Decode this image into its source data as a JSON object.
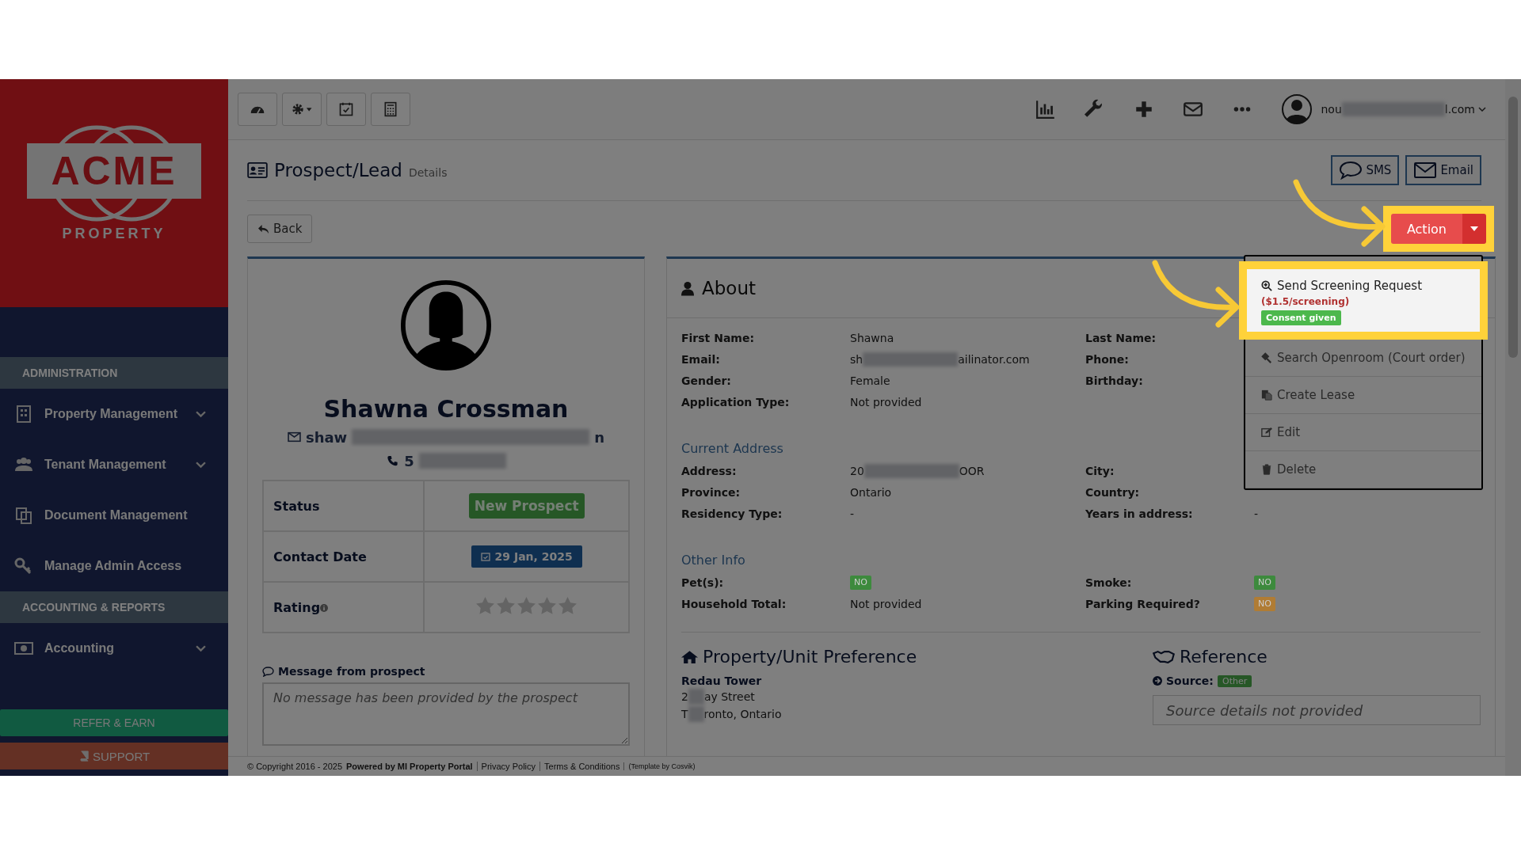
{
  "sidebar": {
    "logo": {
      "word": "ACME",
      "subword": "PROPERTY"
    },
    "sections": [
      {
        "title": "ADMINISTRATION",
        "items": [
          {
            "label": "Property Management",
            "has_submenu": true
          },
          {
            "label": "Tenant Management",
            "has_submenu": true
          },
          {
            "label": "Document Management",
            "has_submenu": false
          },
          {
            "label": "Manage Admin Access",
            "has_submenu": false
          }
        ]
      },
      {
        "title": "ACCOUNTING & REPORTS",
        "items": [
          {
            "label": "Accounting",
            "has_submenu": true
          }
        ]
      }
    ],
    "refer_button": "REFER & EARN",
    "support_button": "SUPPORT"
  },
  "topbar": {
    "user": {
      "name_start": "nou",
      "name_end": "l.com"
    }
  },
  "header": {
    "title": "Prospect/Lead",
    "subtitle": "Details",
    "buttons": [
      "SMS",
      "Email"
    ],
    "back": "Back",
    "action": {
      "label": "Action",
      "highlighted": true
    }
  },
  "action_menu": [
    {
      "label": "Send Screening Request",
      "price": "($1.5/screening)",
      "badge": "Consent given",
      "highlighted": true
    },
    {
      "label": "Search Openroom (Court order)",
      "highlighted": false
    },
    {
      "label": "Create Lease",
      "highlighted": false
    },
    {
      "label": "Edit",
      "highlighted": false
    },
    {
      "label": "Delete",
      "highlighted": false
    }
  ],
  "profile": {
    "name": "Shawna Crossman",
    "email_start": "shaw",
    "email_end": "n",
    "phone_start": "5",
    "details": [
      {
        "kind": "badge",
        "label": "Status",
        "value": "New Prospect"
      },
      {
        "kind": "date",
        "label": "Contact Date",
        "value": "29 Jan, 2025"
      },
      {
        "kind": "rating",
        "label": "Rating",
        "stars": 0
      }
    ],
    "message_label": "Message from prospect",
    "message_placeholder": "No message has been provided by the prospect"
  },
  "about": {
    "title": "About",
    "groups": [
      {
        "rows": [
          {
            "left": {
              "label": "First Name:",
              "value": "Shawna"
            },
            "right": {
              "label": "Last Name:"
            }
          },
          {
            "left": {
              "label": "Email:",
              "value": "sh",
              "value_end": "ailinator.com"
            },
            "right": {
              "label": "Phone:"
            }
          },
          {
            "left": {
              "label": "Gender:",
              "value": "Female"
            },
            "right": {
              "label": "Birthday:"
            }
          },
          {
            "left": {
              "label": "Application Type:",
              "value": "Not provided"
            }
          }
        ]
      },
      {
        "heading": "Current Address",
        "rows": [
          {
            "left": {
              "label": "Address:",
              "value": "20",
              "value_end": "OOR"
            },
            "right": {
              "label": "City:"
            }
          },
          {
            "left": {
              "label": "Province:",
              "value": "Ontario"
            },
            "right": {
              "label": "Country:"
            }
          },
          {
            "left": {
              "label": "Residency Type:",
              "value": "-"
            },
            "right": {
              "label": "Years in address:",
              "value": "-"
            }
          }
        ]
      },
      {
        "heading": "Other Info",
        "rows": [
          {
            "left": {
              "label": "Pet(s):",
              "badge": "NO",
              "color": "#3d8a3d"
            },
            "right": {
              "label": "Smoke:",
              "badge": "NO",
              "color": "#3d8a3d"
            }
          },
          {
            "left": {
              "label": "Household Total:",
              "value": "Not provided"
            },
            "right": {
              "label": "Parking Required?",
              "badge": "NO",
              "color": "#b07c34"
            }
          }
        ]
      }
    ]
  },
  "preference": {
    "title": "Property/Unit Preference",
    "name": "Redau Tower",
    "lines": [
      {
        "start": "2",
        "end": "ay Street"
      },
      {
        "start": "T",
        "end": "ronto, Ontario"
      }
    ]
  },
  "reference": {
    "title": "Reference",
    "source_label": "Source:",
    "source": "Other",
    "placeholder": "Source details not provided"
  },
  "footer": {
    "copyright": "© Copyright 2016 - 2025",
    "powered": "Powered by MI Property Portal",
    "links": [
      "Privacy Policy",
      "Terms & Conditions"
    ],
    "template": "(Template by Cosvik)"
  }
}
